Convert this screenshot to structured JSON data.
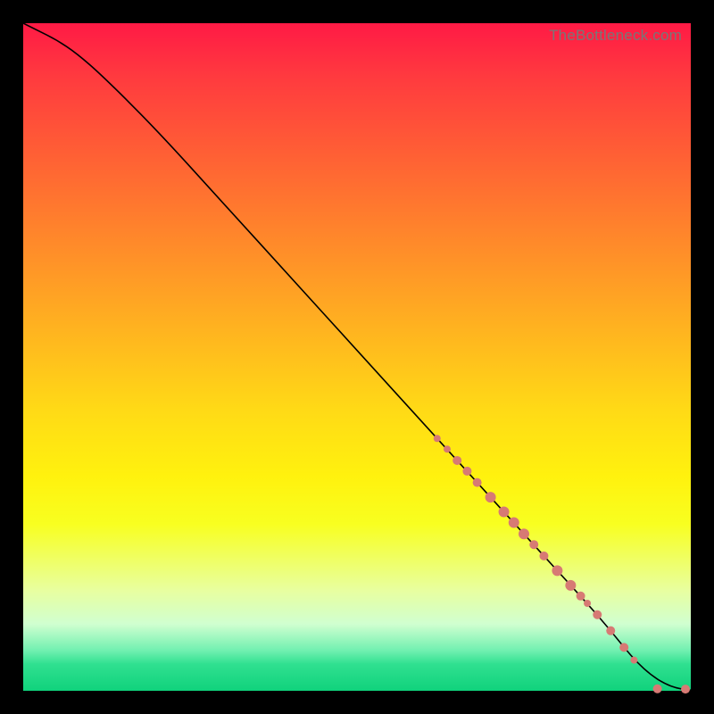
{
  "watermark": "TheBottleneck.com",
  "colors": {
    "marker": "#d77a74",
    "line": "#000000",
    "gradient_top": "#ff1a45",
    "gradient_bottom": "#10d27c",
    "frame_bg": "#000000"
  },
  "chart_data": {
    "type": "line",
    "title": "",
    "xlabel": "",
    "ylabel": "",
    "xlim": [
      0,
      100
    ],
    "ylim": [
      0,
      100
    ],
    "x": [
      0,
      2,
      5,
      8,
      12,
      20,
      30,
      40,
      50,
      60,
      70,
      75,
      80,
      85,
      88,
      90,
      92,
      94,
      96,
      98,
      100
    ],
    "y": [
      100,
      99,
      97.5,
      95.5,
      92,
      84,
      73,
      62,
      51,
      40,
      29,
      23.5,
      18,
      12.5,
      9,
      6.5,
      4.2,
      2.4,
      1.1,
      0.35,
      0.1
    ],
    "markers": {
      "x": [
        62,
        63.5,
        65,
        66.5,
        68,
        70,
        72,
        73.5,
        75,
        76.5,
        78,
        80,
        82,
        83.5,
        84.5,
        86,
        88,
        90,
        91.5,
        95,
        99.2
      ],
      "y": [
        37.8,
        36.2,
        34.5,
        32.9,
        31.2,
        29,
        26.8,
        25.2,
        23.5,
        21.9,
        20.2,
        18,
        15.8,
        14.2,
        13.1,
        11.4,
        9,
        6.5,
        4.6,
        0.3,
        0.25
      ],
      "r": [
        4,
        4,
        5,
        5,
        5,
        6,
        6,
        6,
        6,
        5,
        5,
        6,
        6,
        5,
        4,
        5,
        5,
        5,
        4,
        5,
        5
      ]
    }
  }
}
